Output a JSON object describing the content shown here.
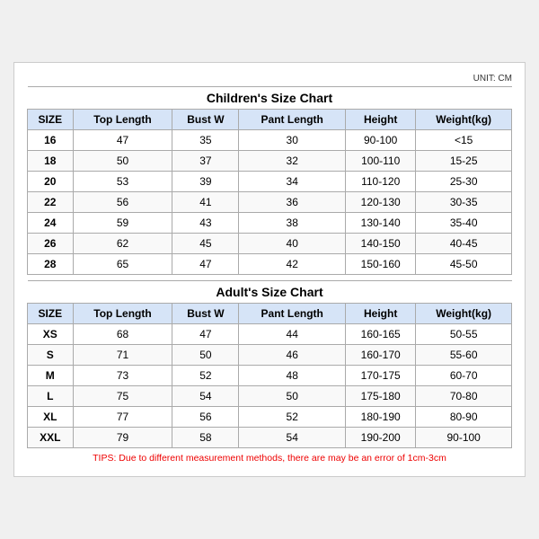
{
  "title": "Children's Size Chart",
  "unit": "UNIT: CM",
  "children": {
    "section_title": "Children's Size Chart",
    "headers": [
      "SIZE",
      "Top Length",
      "Bust W",
      "Pant Length",
      "Height",
      "Weight(kg)"
    ],
    "rows": [
      [
        "16",
        "47",
        "35",
        "30",
        "90-100",
        "<15"
      ],
      [
        "18",
        "50",
        "37",
        "32",
        "100-110",
        "15-25"
      ],
      [
        "20",
        "53",
        "39",
        "34",
        "110-120",
        "25-30"
      ],
      [
        "22",
        "56",
        "41",
        "36",
        "120-130",
        "30-35"
      ],
      [
        "24",
        "59",
        "43",
        "38",
        "130-140",
        "35-40"
      ],
      [
        "26",
        "62",
        "45",
        "40",
        "140-150",
        "40-45"
      ],
      [
        "28",
        "65",
        "47",
        "42",
        "150-160",
        "45-50"
      ]
    ]
  },
  "adults": {
    "section_title": "Adult's Size Chart",
    "headers": [
      "SIZE",
      "Top Length",
      "Bust W",
      "Pant Length",
      "Height",
      "Weight(kg)"
    ],
    "rows": [
      [
        "XS",
        "68",
        "47",
        "44",
        "160-165",
        "50-55"
      ],
      [
        "S",
        "71",
        "50",
        "46",
        "160-170",
        "55-60"
      ],
      [
        "M",
        "73",
        "52",
        "48",
        "170-175",
        "60-70"
      ],
      [
        "L",
        "75",
        "54",
        "50",
        "175-180",
        "70-80"
      ],
      [
        "XL",
        "77",
        "56",
        "52",
        "180-190",
        "80-90"
      ],
      [
        "XXL",
        "79",
        "58",
        "54",
        "190-200",
        "90-100"
      ]
    ]
  },
  "tips": "TIPS: Due to different measurement methods, there are may be an error of 1cm-3cm"
}
